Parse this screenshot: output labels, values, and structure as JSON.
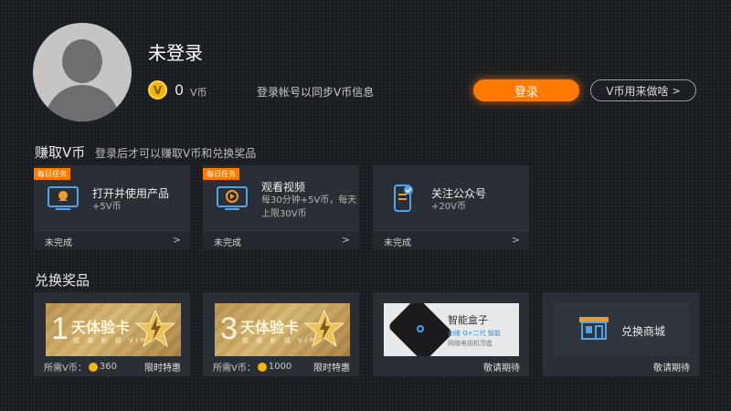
{
  "profile": {
    "name": "未登录",
    "coin_symbol": "V",
    "coins": "0",
    "coin_unit": "V币",
    "sync_tip": "登录帐号以同步V币信息",
    "login_label": "登录",
    "vcoin_usage_label": "V币用来做啥"
  },
  "earn": {
    "title": "赚取V币",
    "subtitle": "登录后才可以赚取V币和兑换奖品",
    "tasks": [
      {
        "badge": "每日任务",
        "title": "打开并使用产品",
        "desc": "+5V币",
        "status": "未完成",
        "icon": "app-icon"
      },
      {
        "badge": "每日任务",
        "title": "观看视频",
        "desc": "每30分钟+5V币，每天上限30V币",
        "status": "未完成",
        "icon": "video-icon"
      },
      {
        "badge": "",
        "title": "关注公众号",
        "desc": "+20V币",
        "status": "未完成",
        "icon": "phone-check-icon"
      }
    ]
  },
  "rewards": {
    "title": "兑换奖品",
    "items": [
      {
        "num": "1",
        "card_title": "天体验卡",
        "card_sub": "超 级 影 视 VIP",
        "price_label": "所需V币：",
        "price": "360",
        "tag": "限时特惠"
      },
      {
        "num": "3",
        "card_title": "天体验卡",
        "card_sub": "超 级 影 视 VIP",
        "price_label": "所需V币：",
        "price": "1000",
        "tag": "限时特惠"
      },
      {
        "box_title": "智能盒子",
        "box_sub1": "创维 Q+二代 智能",
        "box_sub2": "网络电视机顶盒",
        "tag": "敬请期待"
      },
      {
        "mall_title": "兑换商城",
        "tag": "敬请期待"
      }
    ]
  },
  "colors": {
    "accent": "#ff7a00",
    "coin": "#f2b705",
    "card_bg": "#2a2f36",
    "page_bg": "#1a1d21"
  }
}
